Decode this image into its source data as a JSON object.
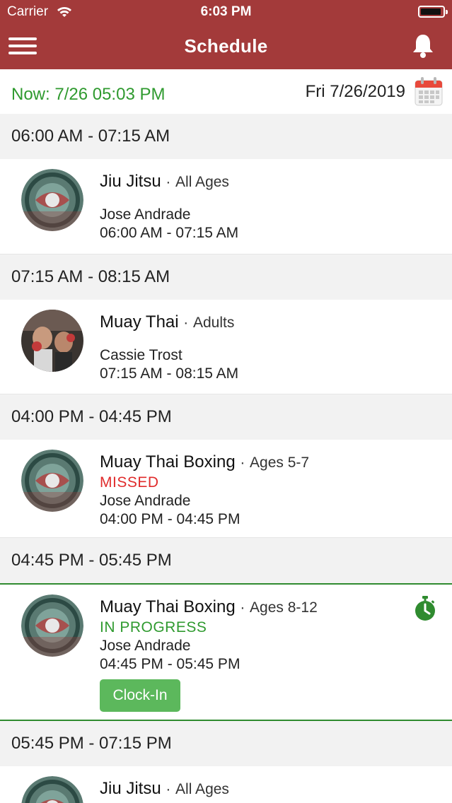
{
  "status_bar": {
    "carrier": "Carrier",
    "time": "6:03 PM"
  },
  "nav": {
    "title": "Schedule"
  },
  "date_bar": {
    "now": "Now: 7/26 05:03 PM",
    "date": "Fri 7/26/2019"
  },
  "colors": {
    "brand": "#a33a3a",
    "green": "#2f9a2f",
    "missed": "#e02b2b",
    "button": "#5cb85c"
  },
  "slots": [
    {
      "time_range": "06:00 AM - 07:15 AM",
      "class_name": "Jiu Jitsu",
      "sep": "·",
      "age_group": "All Ages",
      "status": "",
      "instructor": "Jose Andrade",
      "time": "06:00 AM - 07:15 AM",
      "avatar": "logo"
    },
    {
      "time_range": "07:15 AM - 08:15 AM",
      "class_name": "Muay Thai",
      "sep": "·",
      "age_group": "Adults",
      "status": "",
      "instructor": "Cassie Trost",
      "time": "07:15 AM - 08:15 AM",
      "avatar": "photo"
    },
    {
      "time_range": "04:00 PM - 04:45 PM",
      "class_name": "Muay Thai Boxing",
      "sep": "·",
      "age_group": "Ages 5-7",
      "status": "MISSED",
      "instructor": "Jose Andrade",
      "time": "04:00 PM - 04:45 PM",
      "avatar": "logo"
    },
    {
      "time_range": "04:45 PM - 05:45 PM",
      "class_name": "Muay Thai Boxing",
      "sep": "·",
      "age_group": "Ages 8-12",
      "status": "IN PROGRESS",
      "instructor": "Jose Andrade",
      "time": "04:45 PM - 05:45 PM",
      "avatar": "logo",
      "button": "Clock-In"
    },
    {
      "time_range": "05:45 PM - 07:15 PM",
      "class_name": "Jiu Jitsu",
      "sep": "·",
      "age_group": "All Ages",
      "status": "",
      "instructor": "",
      "time": "",
      "avatar": "logo"
    }
  ]
}
